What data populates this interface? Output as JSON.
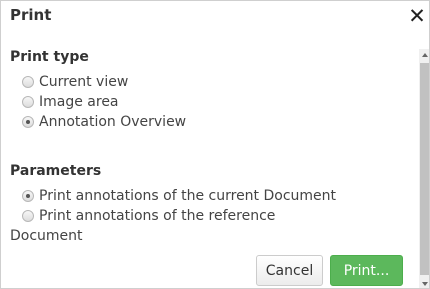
{
  "dialog": {
    "title": "Print",
    "close_icon": "close-icon"
  },
  "print_type": {
    "heading": "Print type",
    "options": [
      {
        "label": "Current view",
        "checked": false
      },
      {
        "label": "Image area",
        "checked": false
      },
      {
        "label": "Annotation Overview",
        "checked": true
      }
    ]
  },
  "parameters": {
    "heading": "Parameters",
    "options": [
      {
        "label": "Print annotations of the current Document",
        "checked": true
      },
      {
        "label": "Print annotations of the reference",
        "continuation": "Document",
        "checked": false
      }
    ]
  },
  "buttons": {
    "cancel_label": "Cancel",
    "print_label": "Print..."
  },
  "colors": {
    "primary_button": "#5cb85c",
    "text": "#333333"
  }
}
